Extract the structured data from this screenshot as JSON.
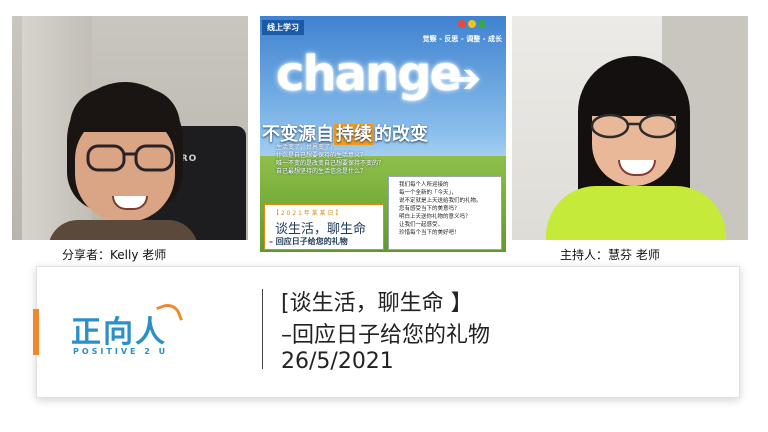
{
  "participants": {
    "left": {
      "caption": "分享者：Kelly 老师",
      "chair_text": "ST RO"
    },
    "right": {
      "caption": "主持人：慧芬 老师"
    }
  },
  "poster": {
    "tag": "线上学习",
    "slogan": "觉察 - 反思 - 调整 - 成长",
    "cloud_word": "change",
    "headline_prefix": "不变源自",
    "headline_highlight": "持续",
    "headline_suffix": "的改变",
    "small_lines": [
      "生活变了，世界变了，",
      "什么是自己想要保持的生活意义？",
      "唯一不变的是改变自己想要保持不变的？",
      "自己最想坚持的生活信念是什么？"
    ],
    "date_bar": "【 2 0 2 1  年 某 某 日 】",
    "title_line1": "谈生活，聊生命",
    "title_line2": "– 回应日子给您的礼物",
    "note_lines": [
      "我们每个人所迎接的",
      "每一个全新的「今天」，",
      "说不定就是上天送给我们的礼物。",
      "您有感受当下的美意吗？",
      "明白上天送你礼物的意义吗？",
      "让我们一起感受，",
      "珍惜每个当下的美好吧！"
    ]
  },
  "banner": {
    "logo_text": "正向人",
    "logo_sub": "POSITIVE 2 U",
    "line1": "[谈生活，聊生命 】",
    "line2": "–回应日子给您的礼物",
    "line3": "26/5/2021"
  },
  "colors": {
    "accent_orange": "#f0892d",
    "logo_blue": "#2b8fc9",
    "host_shirt": "#c6ea3a"
  }
}
